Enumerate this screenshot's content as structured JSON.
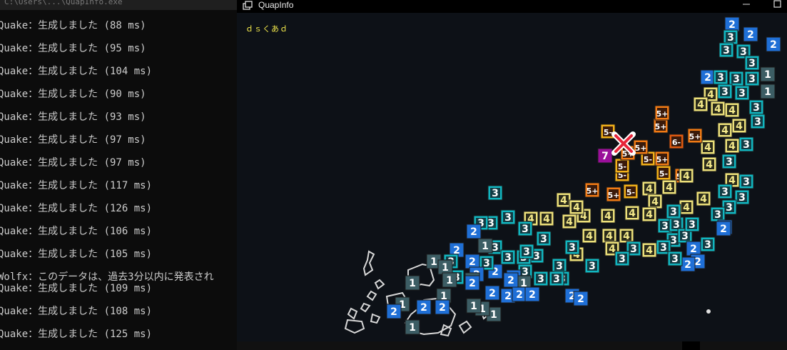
{
  "console": {
    "title": "C:\\Users\\...\\QuapInfo.exe",
    "lines": [
      "Quake：生成しました (88 ms)",
      "Quake：生成しました (95 ms)",
      "Quake：生成しました (104 ms)",
      "Quake：生成しました (90 ms)",
      "Quake：生成しました (93 ms)",
      "Quake：生成しました (97 ms)",
      "Quake：生成しました (97 ms)",
      "Quake：生成しました (117 ms)",
      "Quake：生成しました (126 ms)",
      "Quake：生成しました (106 ms)",
      "Quake：生成しました (105 ms)",
      "Wolfx：このデータは、過去3分以内に発表され",
      "Quake：生成しました (109 ms)",
      "Quake：生成しました (108 ms)",
      "Quake：生成しました (125 ms)"
    ]
  },
  "window": {
    "title": "QuapInfo",
    "label_text": "ｄｓくあｄ"
  },
  "intensity_colors": {
    "1": "#3c5d64",
    "2": "#1f6fd6",
    "3": "#11b6c0",
    "4": "#ece07a",
    "5-": "#f2b019",
    "5+": "#f07a14",
    "6-": "#e05a10",
    "7": "#9a0f9a"
  },
  "epicenter_marker": "x-mark"
}
